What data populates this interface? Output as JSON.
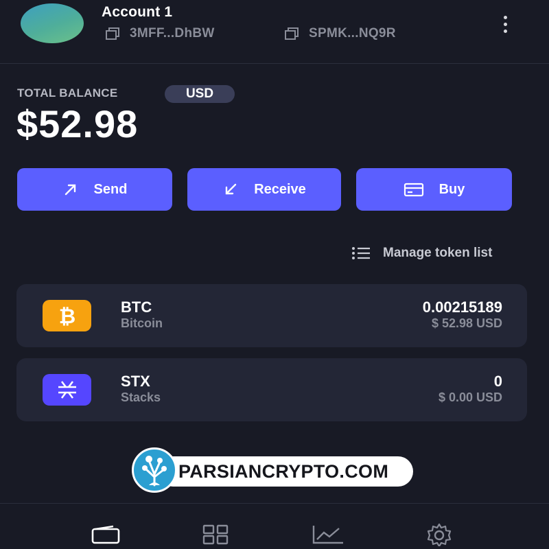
{
  "header": {
    "account_name": "Account 1",
    "btc_address": "3MFF...DhBW",
    "stx_address": "SPMK...NQ9R",
    "avatar_colors": [
      "#3d9fc0",
      "#6cc18a"
    ]
  },
  "balance": {
    "label": "TOTAL BALANCE",
    "currency": "USD",
    "amount": "$52.98"
  },
  "actions": {
    "send_label": "Send",
    "receive_label": "Receive",
    "buy_label": "Buy",
    "accent_color": "#5b5fff"
  },
  "manage_label": "Manage token list",
  "tokens": [
    {
      "symbol": "BTC",
      "name": "Bitcoin",
      "amount": "0.00215189",
      "value": "$ 52.98 USD",
      "icon": "bitcoin-icon",
      "color": "#f7a20f"
    },
    {
      "symbol": "STX",
      "name": "Stacks",
      "amount": "0",
      "value": "$ 0.00 USD",
      "icon": "stacks-icon",
      "color": "#5546ff"
    }
  ],
  "watermark": {
    "text": "PARSIANCRYPTO.COM"
  },
  "nav": {
    "items": [
      "wallet-icon",
      "apps-grid-icon",
      "activity-chart-icon",
      "settings-gear-icon"
    ]
  }
}
